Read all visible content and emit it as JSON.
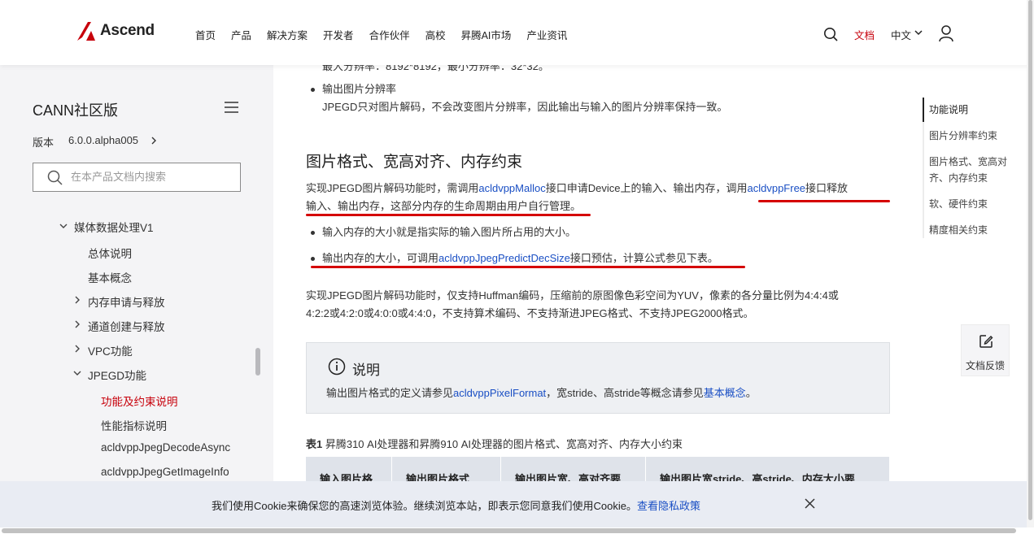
{
  "header": {
    "logo_text": "Ascend",
    "nav": [
      "首页",
      "产品",
      "解决方案",
      "开发者",
      "合作伙伴",
      "高校",
      "昇腾AI市场",
      "产业资讯"
    ],
    "docs_label": "文档",
    "lang_label": "中文"
  },
  "sidebar": {
    "title": "CANN社区版",
    "version_label": "版本",
    "version_value": "6.0.0.alpha005",
    "search_placeholder": "在本产品文档内搜索",
    "tree": [
      {
        "label": "媒体数据处理V1",
        "expanded": true
      },
      {
        "label": "总体说明"
      },
      {
        "label": "基本概念"
      },
      {
        "label": "内存申请与释放",
        "expanded": false
      },
      {
        "label": "通道创建与释放",
        "expanded": false
      },
      {
        "label": "VPC功能",
        "expanded": false
      },
      {
        "label": "JPEGD功能",
        "expanded": true
      },
      {
        "label": "功能及约束说明",
        "active": true
      },
      {
        "label": "性能指标说明"
      },
      {
        "label": "acldvppJpegDecodeAsync"
      },
      {
        "label": "acldvppJpegGetImageInfo"
      }
    ]
  },
  "content": {
    "cut_line": "最大分辨率：8192*8192，最小分辨率：32*32。",
    "bullet_out_res_title": "输出图片分辨率",
    "bullet_out_res_body": "JPEGD只对图片解码，不会改变图片分辨率，因此输出与输入的图片分辨率保持一致。",
    "heading": "图片格式、宽高对齐、内存约束",
    "para1_a": "实现JPEGD图片解码功能时，需调用",
    "para1_link1": "acldvppMalloc",
    "para1_b": "接口申请Device上的输入、输出内存，",
    "para1_c": "调用",
    "para1_link2": "acldvppFree",
    "para1_d": "接口释放",
    "para1_e": "输入、输出内存，这部分内存的生命周期由用户自行管理",
    "para1_f": "。",
    "bullet2": "输入内存的大小就是指实际的输入图片所占用的大小。",
    "bullet3_a": "输出内存的大小，可调用",
    "bullet3_link": "acldvppJpegPredictDecSize",
    "bullet3_b": "接口预估，计算公式参见下表。",
    "para2_line1": "实现JPEGD图片解码功能时，仅支持Huffman编码，压缩前的原图像色彩空间为YUV，像素的各分量比例为4:4:4或",
    "para2_line2": "4:2:2或4:2:0或4:0:0或4:4:0，不支持算术编码、不支持渐进JPEG格式、不支持JPEG2000格式。",
    "note_title": "说明",
    "note_a": "输出图片格式的定义请参见",
    "note_link1": "acldvppPixelFormat",
    "note_b": "，宽stride、高stride等概念请参见",
    "note_link2": "基本概念",
    "note_c": "。",
    "table_caption_bold": "表1",
    "table_caption": " 昇腾310 AI处理器和昇腾910 AI处理器的图片格式、宽高对齐、内存大小约束",
    "table_headers": [
      "输入图片格",
      "输出图片格式",
      "输出图片宽、高对齐要",
      "输出图片宽stride、高stride、内存大小要"
    ]
  },
  "toc": [
    "功能说明",
    "图片分辨率约束",
    "图片格式、宽高对齐、内存约束",
    "软、硬件约束",
    "精度相关约束"
  ],
  "feedback_label": "文档反馈",
  "cookie": {
    "text": "我们使用Cookie来确保您的高速浏览体验。继续浏览本站，即表示您同意我们使用Cookie。",
    "link": "查看隐私政策"
  },
  "colors": {
    "brand_red": "#c7000b",
    "link_blue": "#1a4fc4",
    "underline_red": "#d50000"
  }
}
